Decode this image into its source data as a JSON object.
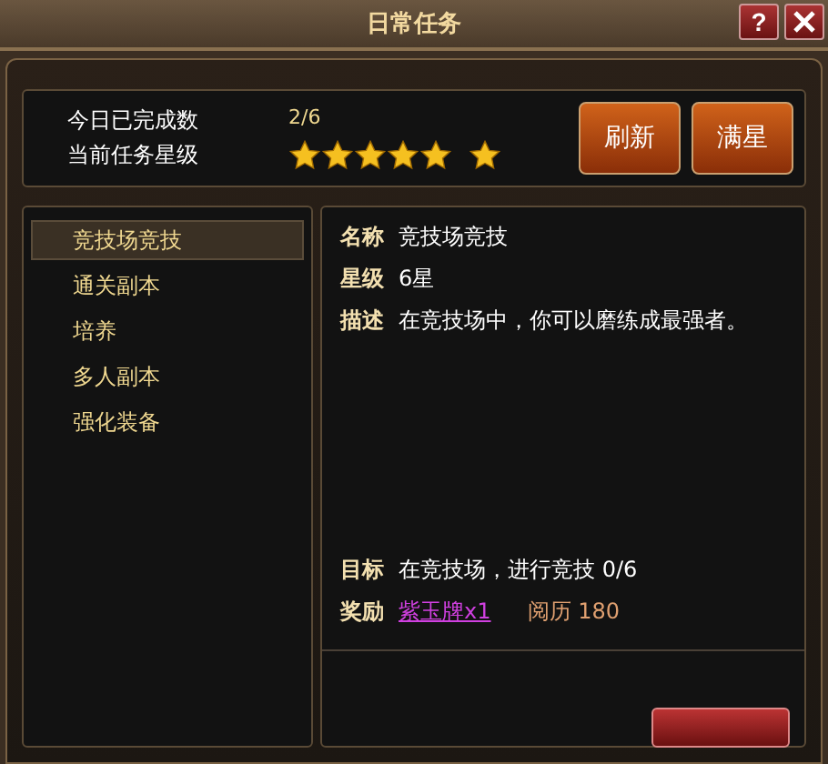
{
  "window": {
    "title": "日常任务",
    "buttons": [
      "?"
    ]
  },
  "summary": {
    "completed_label": "今日已完成数",
    "completed": "2/6",
    "star_label": "当前任务星级",
    "stars": 6
  },
  "actions": [
    "刷新",
    "满星"
  ],
  "tasks": [
    {
      "label": "竞技场竞技",
      "selected": true
    },
    {
      "label": "通关副本",
      "selected": false
    },
    {
      "label": "培养",
      "selected": false
    },
    {
      "label": "多人副本",
      "selected": false
    },
    {
      "label": "强化装备",
      "selected": false
    }
  ],
  "detail": {
    "fields": [
      {
        "label": "名称",
        "value": "竞技场竞技"
      },
      {
        "label": "星级",
        "value": "6星"
      },
      {
        "label": "描述",
        "value": "在竞技场中，你可以磨练成最强者。"
      }
    ],
    "goal": {
      "label": "目标",
      "value": "在竞技场，进行竞技 0/6"
    },
    "reward": {
      "label": "奖励",
      "item": "紫玉牌x1",
      "exp_label": "阅历",
      "exp": "180"
    }
  }
}
